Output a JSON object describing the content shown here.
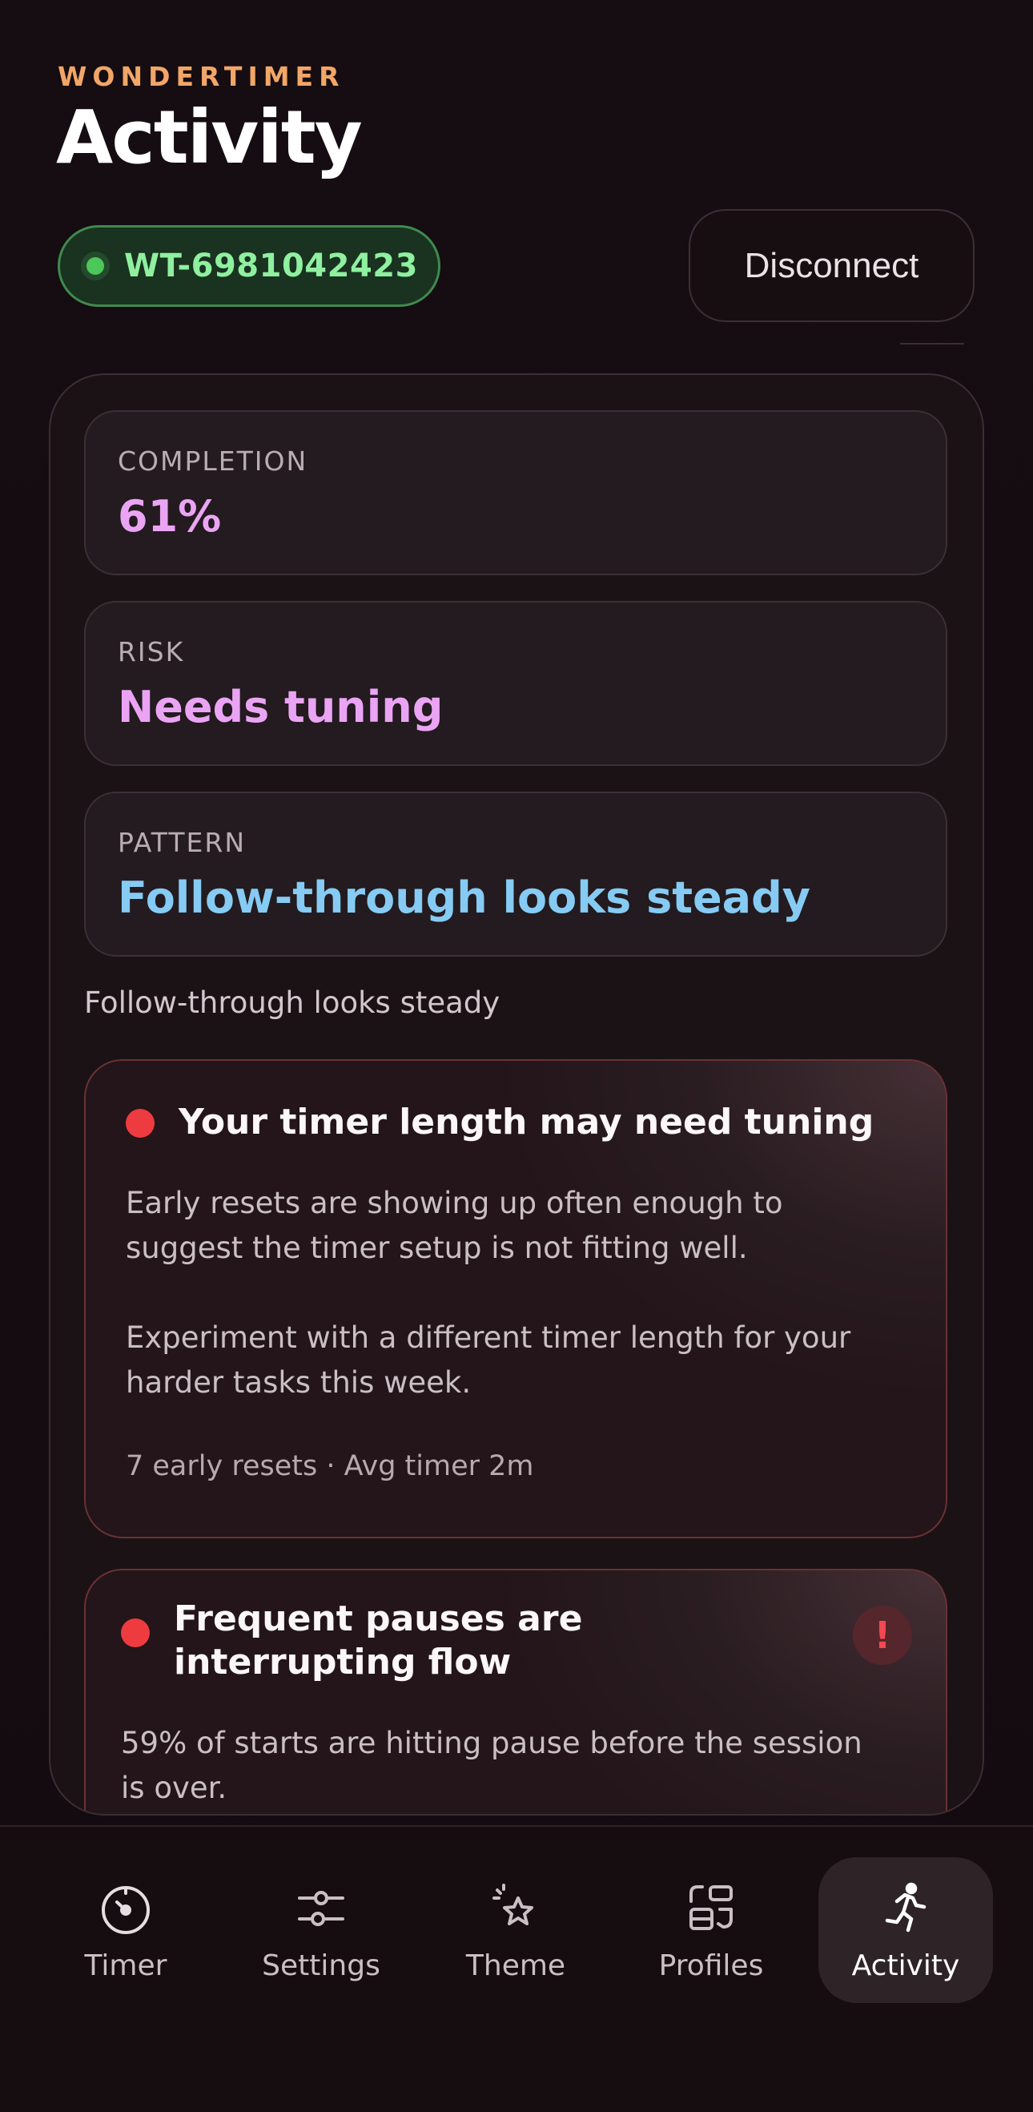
{
  "app": {
    "brand": "WONDERTIMER",
    "title": "Activity"
  },
  "device": {
    "id": "WT-6981042423",
    "status_color": "#4cc75a"
  },
  "actions": {
    "disconnect_label": "Disconnect"
  },
  "stats": [
    {
      "label": "COMPLETION",
      "value": "61%",
      "color": "#eba4f4"
    },
    {
      "label": "RISK",
      "value": "Needs tuning",
      "color": "#eba4f4"
    },
    {
      "label": "PATTERN",
      "value": "Follow-through looks steady",
      "color": "#86cbf3"
    }
  ],
  "summary": "Follow-through looks steady",
  "insights": [
    {
      "title": "Your timer length may need tuning",
      "body": "Early resets are showing up often enough to suggest the timer setup is not fitting well.",
      "suggestion": "Experiment with a different timer length for your harder tasks this week.",
      "meta": "7 early resets · Avg timer 2m"
    },
    {
      "title": "Frequent pauses are interrupting flow",
      "body": "59% of starts are hitting pause before the session is over.",
      "badge": "!"
    }
  ],
  "tabs": [
    {
      "label": "Timer",
      "icon": "timer-icon"
    },
    {
      "label": "Settings",
      "icon": "sliders-icon"
    },
    {
      "label": "Theme",
      "icon": "sparkle-star-icon"
    },
    {
      "label": "Profiles",
      "icon": "profiles-icon"
    },
    {
      "label": "Activity",
      "icon": "running-person-icon",
      "active": true
    }
  ],
  "colors": {
    "accent_brand": "#f2a667",
    "alert_red": "#ee3b40",
    "success_green": "#8ff0a0"
  }
}
